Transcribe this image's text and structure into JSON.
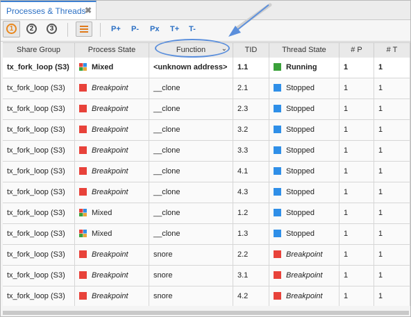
{
  "tab": {
    "title": "Processes & Threads",
    "close": "✖"
  },
  "toolbar": {
    "levels": [
      "1",
      "2",
      "3"
    ],
    "buttons": [
      "P+",
      "P-",
      "Px",
      "T+",
      "T-"
    ]
  },
  "columns": [
    "Share Group",
    "Process State",
    "Function",
    "TID",
    "Thread State",
    "# P",
    "# T"
  ],
  "rows": [
    {
      "share": "tx_fork_loop (S3)",
      "pstate": "Mixed",
      "pcolor": "mixed",
      "func": "<unknown address>",
      "tid": "1.1",
      "tstate": "Running",
      "tcolor": "green",
      "p": "1",
      "t": "1"
    },
    {
      "share": "tx_fork_loop (S3)",
      "pstate": "Breakpoint",
      "pcolor": "red",
      "func": "__clone",
      "tid": "2.1",
      "tstate": "Stopped",
      "tcolor": "blue",
      "p": "1",
      "t": "1"
    },
    {
      "share": "tx_fork_loop (S3)",
      "pstate": "Breakpoint",
      "pcolor": "red",
      "func": "__clone",
      "tid": "2.3",
      "tstate": "Stopped",
      "tcolor": "blue",
      "p": "1",
      "t": "1"
    },
    {
      "share": "tx_fork_loop (S3)",
      "pstate": "Breakpoint",
      "pcolor": "red",
      "func": "__clone",
      "tid": "3.2",
      "tstate": "Stopped",
      "tcolor": "blue",
      "p": "1",
      "t": "1"
    },
    {
      "share": "tx_fork_loop (S3)",
      "pstate": "Breakpoint",
      "pcolor": "red",
      "func": "__clone",
      "tid": "3.3",
      "tstate": "Stopped",
      "tcolor": "blue",
      "p": "1",
      "t": "1"
    },
    {
      "share": "tx_fork_loop (S3)",
      "pstate": "Breakpoint",
      "pcolor": "red",
      "func": "__clone",
      "tid": "4.1",
      "tstate": "Stopped",
      "tcolor": "blue",
      "p": "1",
      "t": "1"
    },
    {
      "share": "tx_fork_loop (S3)",
      "pstate": "Breakpoint",
      "pcolor": "red",
      "func": "__clone",
      "tid": "4.3",
      "tstate": "Stopped",
      "tcolor": "blue",
      "p": "1",
      "t": "1"
    },
    {
      "share": "tx_fork_loop (S3)",
      "pstate": "Mixed",
      "pcolor": "mixed",
      "func": "__clone",
      "tid": "1.2",
      "tstate": "Stopped",
      "tcolor": "blue",
      "p": "1",
      "t": "1"
    },
    {
      "share": "tx_fork_loop (S3)",
      "pstate": "Mixed",
      "pcolor": "mixed",
      "func": "__clone",
      "tid": "1.3",
      "tstate": "Stopped",
      "tcolor": "blue",
      "p": "1",
      "t": "1"
    },
    {
      "share": "tx_fork_loop (S3)",
      "pstate": "Breakpoint",
      "pcolor": "red",
      "func": "snore",
      "tid": "2.2",
      "tstate": "Breakpoint",
      "tcolor": "red",
      "p": "1",
      "t": "1"
    },
    {
      "share": "tx_fork_loop (S3)",
      "pstate": "Breakpoint",
      "pcolor": "red",
      "func": "snore",
      "tid": "3.1",
      "tstate": "Breakpoint",
      "tcolor": "red",
      "p": "1",
      "t": "1"
    },
    {
      "share": "tx_fork_loop (S3)",
      "pstate": "Breakpoint",
      "pcolor": "red",
      "func": "snore",
      "tid": "4.2",
      "tstate": "Breakpoint",
      "tcolor": "red",
      "p": "1",
      "t": "1"
    }
  ]
}
